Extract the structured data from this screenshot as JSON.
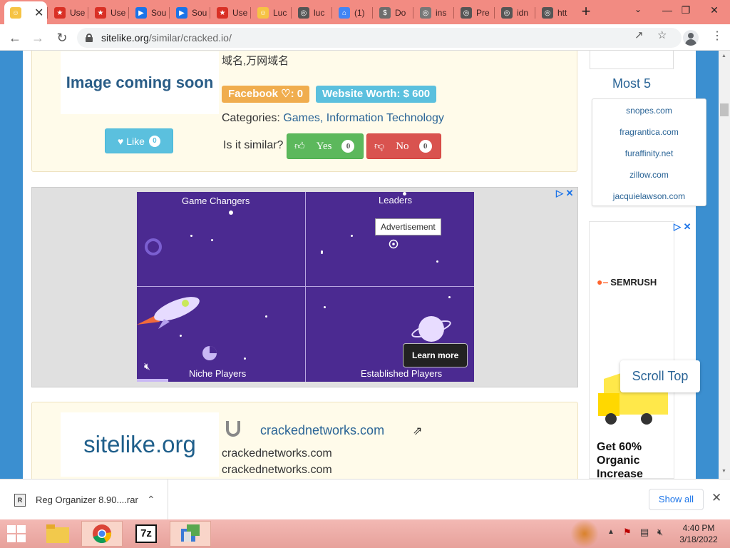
{
  "browser": {
    "tabs": [
      {
        "label": "",
        "icon": "emoji-icon",
        "color": "#f6c344",
        "active": true
      },
      {
        "label": "Use",
        "icon": "star-icon",
        "color": "#d93025"
      },
      {
        "label": "Use",
        "icon": "star-icon",
        "color": "#d93025"
      },
      {
        "label": "Sou",
        "icon": "play-icon",
        "color": "#1a73e8"
      },
      {
        "label": "Sou",
        "icon": "play-icon",
        "color": "#1a73e8"
      },
      {
        "label": "Use",
        "icon": "star-icon",
        "color": "#d93025"
      },
      {
        "label": "Luc",
        "icon": "smiley-icon",
        "color": "#f6c344"
      },
      {
        "label": "luc",
        "icon": "globe-icon",
        "color": "#555555"
      },
      {
        "label": "(1)",
        "icon": "home-icon",
        "color": "#4285f4"
      },
      {
        "label": "Do",
        "icon": "dollar-icon",
        "color": "#6d6d6d"
      },
      {
        "label": "ins",
        "icon": "globe-icon",
        "color": "#777777"
      },
      {
        "label": "Pre",
        "icon": "globe-icon",
        "color": "#555555"
      },
      {
        "label": "idn",
        "icon": "globe-icon",
        "color": "#555555"
      },
      {
        "label": "htt",
        "icon": "globe-icon",
        "color": "#555555"
      }
    ],
    "url_host": "sitelike.org",
    "url_path": "/similar/cracked.io/"
  },
  "top_card": {
    "thumb_text": "Image coming soon",
    "domain_names": "域名,万网域名",
    "facebook_badge": "Facebook ♡: 0",
    "worth_badge": "Website Worth: $ 600",
    "categories_label": "Categories:",
    "categories": "Games, Information Technology",
    "similar_question": "Is it similar?",
    "yes_label": "Yes",
    "yes_count": "0",
    "no_label": "No",
    "no_count": "0",
    "like_label": "Like",
    "like_count": "0"
  },
  "ad": {
    "quadrants": [
      "Game Changers",
      "Leaders",
      "Niche Players",
      "Established Players"
    ],
    "tooltip": "Advertisement",
    "learn_more": "Learn more"
  },
  "second_card": {
    "thumb_text": "sitelike.org",
    "title": "crackednetworks.com",
    "line1": "crackednetworks.com",
    "line2": "crackednetworks.com"
  },
  "sidebar": {
    "heading": "Most 5",
    "sites": [
      "snopes.com",
      "fragrantica.com",
      "furaffinity.net",
      "zillow.com",
      "jacquielawson.com"
    ],
    "ad_brand": "SEMRUSH",
    "ad_text": "Get 60% Organic Increase",
    "scroll_top": "Scroll Top"
  },
  "downloads": {
    "file": "Reg Organizer 8.90....rar",
    "show_all": "Show all"
  },
  "taskbar": {
    "time": "4:40 PM",
    "date": "3/18/2022"
  }
}
